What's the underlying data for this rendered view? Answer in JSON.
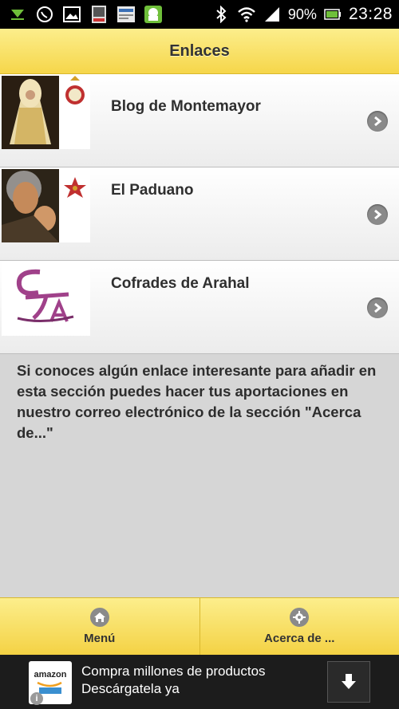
{
  "status_bar": {
    "battery_percent": "90%",
    "time": "23:28",
    "left_icons": [
      "download-notification-icon",
      "whatsapp-icon",
      "gallery-icon",
      "app-notification-icon",
      "news-notification-icon",
      "android-robot-icon"
    ],
    "right_icons": [
      "bluetooth-icon",
      "wifi-icon",
      "signal-icon",
      "battery-icon"
    ]
  },
  "header": {
    "title": "Enlaces"
  },
  "links": [
    {
      "label": "Blog de Montemayor",
      "thumb": "montemayor-image"
    },
    {
      "label": "El Paduano",
      "thumb": "paduano-image"
    },
    {
      "label": "Cofrades de Arahal",
      "thumb": "cofrades-logo"
    }
  ],
  "info_text": "Si conoces algún enlace interesante para añadir en esta sección puedes hacer tus aportaciones en nuestro correo electrónico de la sección \"Acerca de...\"",
  "footer": {
    "tabs": [
      {
        "label": "Menú",
        "icon": "home-icon"
      },
      {
        "label": "Acerca de ...",
        "icon": "gear-icon"
      }
    ]
  },
  "ad": {
    "brand": "amazon",
    "text": "Compra millones de productos Descárgatela ya"
  },
  "colors": {
    "header_yellow": "#f6d64a",
    "status_bar": "#000000",
    "background": "#d6d6d6",
    "ad_background": "#1c1c1c"
  }
}
